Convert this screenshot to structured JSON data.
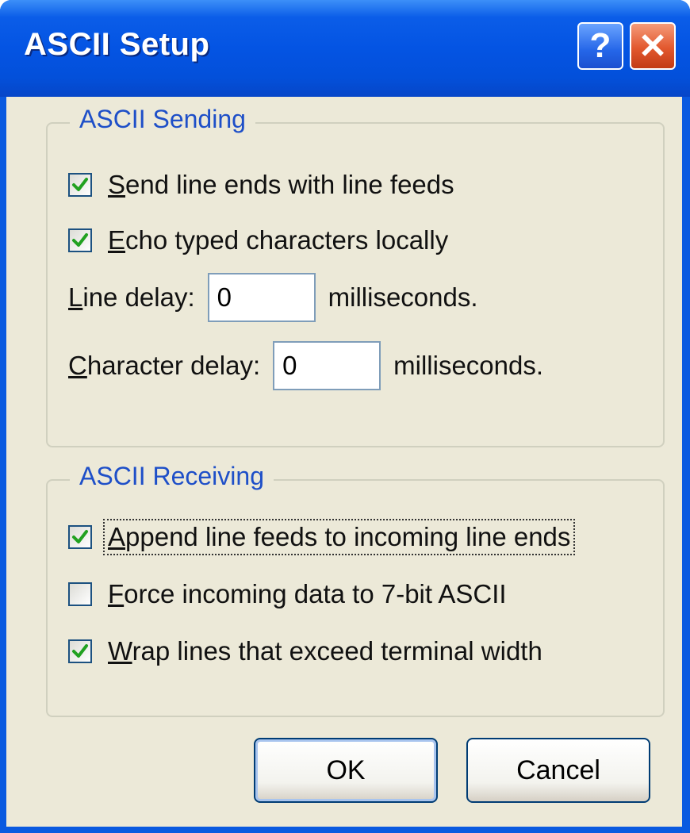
{
  "window": {
    "title": "ASCII Setup",
    "help_glyph": "?",
    "close_glyph": "✕",
    "accent": "#0454e3"
  },
  "sending": {
    "legend": "ASCII Sending",
    "send_line_ends": {
      "prefix": "S",
      "rest": "end line ends with line feeds",
      "checked": true
    },
    "echo_typed": {
      "prefix": "E",
      "rest": "cho typed characters locally",
      "checked": true
    },
    "line_delay": {
      "prefix": "L",
      "rest": "ine delay:",
      "value": "0",
      "unit": "milliseconds."
    },
    "character_delay": {
      "prefix": "C",
      "rest": "haracter delay:",
      "value": "0",
      "unit": "milliseconds."
    }
  },
  "receiving": {
    "legend": "ASCII Receiving",
    "append_line_feeds": {
      "prefix": "A",
      "rest": "ppend line feeds to incoming line ends",
      "checked": true
    },
    "force_7bit": {
      "prefix": "F",
      "rest": "orce incoming data to 7-bit ASCII",
      "checked": false
    },
    "wrap_lines": {
      "prefix": "W",
      "rest": "rap lines that exceed terminal width",
      "checked": true
    }
  },
  "buttons": {
    "ok": "OK",
    "cancel": "Cancel"
  },
  "icons": {
    "check": "checkmark-icon",
    "help": "help-icon",
    "close": "close-icon"
  }
}
